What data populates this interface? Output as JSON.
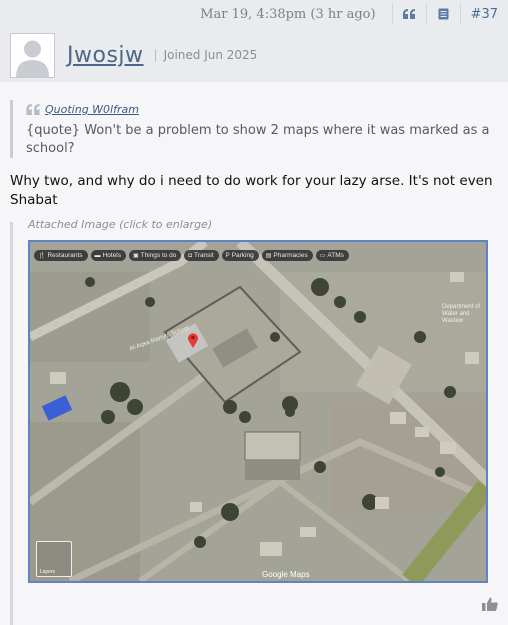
{
  "post": {
    "timestamp": "Mar 19, 4:38pm (3 hr ago)",
    "post_number": "#37"
  },
  "user": {
    "name": "Jwosjw",
    "joined": "Joined Jun 2025"
  },
  "quote": {
    "author": "Quoting W0lfram",
    "text": "{quote} Won't be a problem to show 2 maps where it was marked as a school?"
  },
  "body": {
    "text": "Why two, and why do i need to do work for your lazy arse. It's not even Shabat"
  },
  "attachment": {
    "label": "Attached Image (click to enlarge)",
    "map": {
      "chips": [
        "Restaurants",
        "Hotels",
        "Things to do",
        "Transit",
        "Parking",
        "Pharmacies",
        "ATMs"
      ],
      "place_label": "Al-Aqsa Martyrs School",
      "right_label": "Department of Water and Wastew",
      "layers_label": "Layers",
      "watermark": "Google Maps"
    }
  },
  "icons": [
    "quote-icon",
    "bookmark-icon",
    "avatar-placeholder-icon",
    "map-pin-icon",
    "like-icon"
  ],
  "colors": {
    "link": "#4d6787",
    "accent": "#4a6b94",
    "map_border": "#5f84c2"
  }
}
